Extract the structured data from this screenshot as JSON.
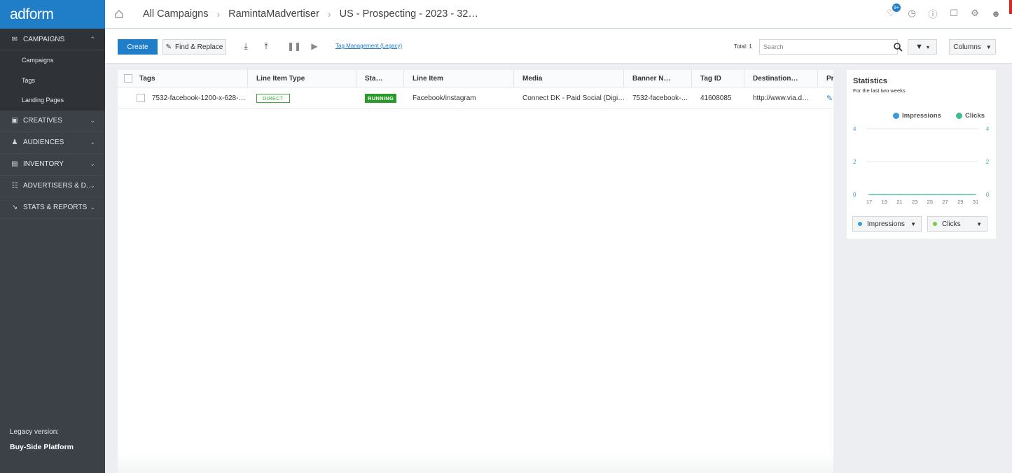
{
  "app": {
    "logo": "adform"
  },
  "sidebar": {
    "sections": [
      {
        "label": "CAMPAIGNS",
        "icon": "megaphone-icon",
        "expanded": true
      },
      {
        "label": "CREATIVES",
        "icon": "image-icon",
        "expanded": false
      },
      {
        "label": "AUDIENCES",
        "icon": "users-icon",
        "expanded": false
      },
      {
        "label": "INVENTORY",
        "icon": "document-icon",
        "expanded": false
      },
      {
        "label": "ADVERTISERS & D…",
        "icon": "advertisers-icon",
        "expanded": false
      },
      {
        "label": "STATS & REPORTS",
        "icon": "chart-icon",
        "expanded": false
      }
    ],
    "sub_items": [
      "Campaigns",
      "Tags",
      "Landing Pages"
    ],
    "legacy_label": "Legacy version:",
    "legacy_link": "Buy-Side Platform"
  },
  "breadcrumb": [
    "All Campaigns",
    "RamintaMadvertiser",
    "US - Prospecting - 2023 - 32…"
  ],
  "topbar": {
    "notification_count": "9+"
  },
  "toolbar": {
    "create_label": "Create",
    "find_replace_label": "Find & Replace",
    "tag_management_label": "Tag Management (Legacy)",
    "total_label": "Total: 1",
    "search_placeholder": "Search",
    "columns_label": "Columns"
  },
  "table": {
    "columns": [
      "Tags",
      "Line Item Type",
      "Sta…",
      "Line Item",
      "Media",
      "Banner N…",
      "Tag ID",
      "Destination…",
      "Pr"
    ],
    "rows": [
      {
        "tag": "7532-facebook-1200-x-628-px-…",
        "line_item_type": "DIRECT",
        "status": "RUNNING",
        "line_item": "Facebook/instagram",
        "media": "Connect DK - Paid Social (Digi…",
        "banner_name": "7532-facebook-…",
        "tag_id": "41608085",
        "destination": "http://www.via.d…"
      }
    ]
  },
  "statistics": {
    "title": "Statistics",
    "subtitle": "For the last two weeks",
    "legend": [
      {
        "name": "Impressions",
        "color": "#3b9bd8"
      },
      {
        "name": "Clicks",
        "color": "#3fba8f"
      }
    ],
    "left_ticks": [
      "4",
      "2",
      "0"
    ],
    "right_ticks": [
      "4",
      "2",
      "0"
    ],
    "x_ticks": [
      "17",
      "19",
      "21",
      "23",
      "25",
      "27",
      "29",
      "31"
    ],
    "metric_left": {
      "label": "Impressions",
      "color": "#3b9bd8"
    },
    "metric_right": {
      "label": "Clicks",
      "color": "#7ac943"
    }
  },
  "chart_data": {
    "type": "line",
    "title": "Statistics",
    "subtitle": "For the last two weeks",
    "x": [
      "17",
      "19",
      "21",
      "23",
      "25",
      "27",
      "29",
      "31"
    ],
    "series": [
      {
        "name": "Impressions",
        "values": [
          0,
          0,
          0,
          0,
          0,
          0,
          0,
          0
        ]
      },
      {
        "name": "Clicks",
        "values": [
          0,
          0,
          0,
          0,
          0,
          0,
          0,
          0
        ]
      }
    ],
    "ylim": [
      0,
      4
    ],
    "y2lim": [
      0,
      4
    ],
    "legend": "top-right",
    "grid": true
  }
}
